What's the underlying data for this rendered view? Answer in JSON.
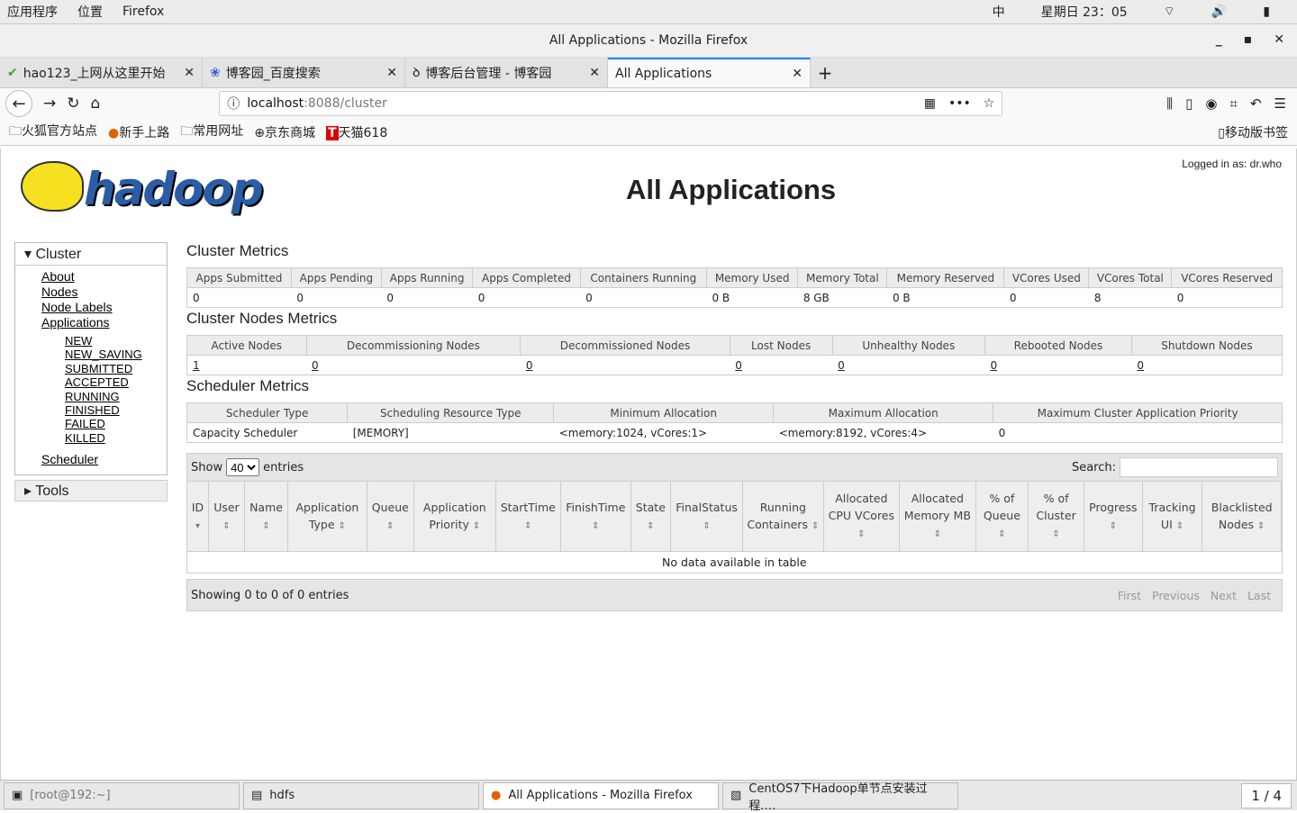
{
  "system": {
    "menu": [
      "应用程序",
      "位置",
      "Firefox"
    ],
    "ime": "中",
    "clock": "星期日 23：05"
  },
  "window": {
    "title": "All Applications - Mozilla Firefox",
    "controls": [
      "_",
      "▪",
      "✕"
    ]
  },
  "tabs": [
    {
      "label": "hao123_上网从这里开始"
    },
    {
      "label": "博客园_百度搜索"
    },
    {
      "label": "博客后台管理 - 博客园"
    },
    {
      "label": "All Applications",
      "active": true
    }
  ],
  "url": {
    "host": "localhost",
    "path": ":8088/cluster"
  },
  "bookmarks": [
    "火狐官方站点",
    "新手上路",
    "常用网址",
    "京东商城",
    "天猫618"
  ],
  "bookmarks_mobile": "移动版书签",
  "page": {
    "title": "All Applications",
    "logged_in": "Logged in as: dr.who",
    "logo": "hadoop"
  },
  "sidebar": {
    "cluster_label": "Cluster",
    "links": [
      "About",
      "Nodes",
      "Node Labels",
      "Applications"
    ],
    "states": [
      "NEW",
      "NEW_SAVING",
      "SUBMITTED",
      "ACCEPTED",
      "RUNNING",
      "FINISHED",
      "FAILED",
      "KILLED"
    ],
    "scheduler": "Scheduler",
    "tools": "Tools"
  },
  "cluster_metrics": {
    "title": "Cluster Metrics",
    "headers": [
      "Apps Submitted",
      "Apps Pending",
      "Apps Running",
      "Apps Completed",
      "Containers Running",
      "Memory Used",
      "Memory Total",
      "Memory Reserved",
      "VCores Used",
      "VCores Total",
      "VCores Reserved"
    ],
    "values": [
      "0",
      "0",
      "0",
      "0",
      "0",
      "0 B",
      "8 GB",
      "0 B",
      "0",
      "8",
      "0"
    ]
  },
  "nodes_metrics": {
    "title": "Cluster Nodes Metrics",
    "headers": [
      "Active Nodes",
      "Decommissioning Nodes",
      "Decommissioned Nodes",
      "Lost Nodes",
      "Unhealthy Nodes",
      "Rebooted Nodes",
      "Shutdown Nodes"
    ],
    "values": [
      "1",
      "0",
      "0",
      "0",
      "0",
      "0",
      "0"
    ]
  },
  "scheduler_metrics": {
    "title": "Scheduler Metrics",
    "headers": [
      "Scheduler Type",
      "Scheduling Resource Type",
      "Minimum Allocation",
      "Maximum Allocation",
      "Maximum Cluster Application Priority"
    ],
    "values": [
      "Capacity Scheduler",
      "[MEMORY]",
      "<memory:1024, vCores:1>",
      "<memory:8192, vCores:4>",
      "0"
    ]
  },
  "apps_table": {
    "show": "Show",
    "entries_value": "40",
    "entries": "entries",
    "search_label": "Search:",
    "search_value": "",
    "columns": [
      "ID",
      "User",
      "Name",
      "Application Type",
      "Queue",
      "Application Priority",
      "StartTime",
      "FinishTime",
      "State",
      "FinalStatus",
      "Running Containers",
      "Allocated CPU VCores",
      "Allocated Memory MB",
      "% of Queue",
      "% of Cluster",
      "Progress",
      "Tracking UI",
      "Blacklisted Nodes"
    ],
    "empty": "No data available in table",
    "info": "Showing 0 to 0 of 0 entries",
    "pager": [
      "First",
      "Previous",
      "Next",
      "Last"
    ]
  },
  "taskbar": {
    "items": [
      "[root@192:~]",
      "hdfs",
      "All Applications - Mozilla Firefox",
      "CentOS7下Hadoop单节点安装过程.…"
    ],
    "workspace": "1 / 4"
  }
}
